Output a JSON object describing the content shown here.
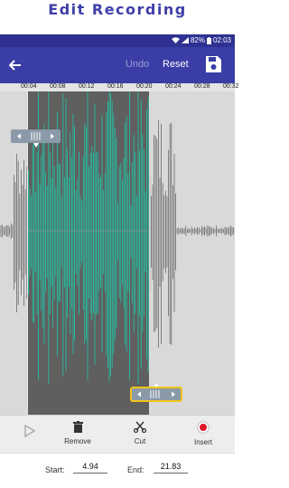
{
  "banner": {
    "title": "Edit Recording"
  },
  "status": {
    "battery": "82%",
    "time": "02:03"
  },
  "toolbar": {
    "undo_label": "Undo",
    "reset_label": "Reset"
  },
  "timeline": {
    "ticks": [
      "00:04",
      "00:08",
      "00:12",
      "00:16",
      "00:20",
      "00:24",
      "00:28",
      "00:32"
    ]
  },
  "selection": {
    "start_seconds": 4.94,
    "end_seconds": 21.83
  },
  "tools": {
    "play_label": "",
    "remove_label": "Remove",
    "cut_label": "Cut",
    "insert_label": "Insert"
  },
  "fields": {
    "start_label": "Start:",
    "start_value": "4.94",
    "end_label": "End:",
    "end_value": "21.83"
  },
  "colors": {
    "primary": "#3a3da6",
    "status": "#2e3190",
    "selection_bg": "#5f5f5f",
    "wave_selected": "#1ec9a8",
    "wave_unselected": "#6a6a6a",
    "handle_highlight": "#f0c419"
  }
}
